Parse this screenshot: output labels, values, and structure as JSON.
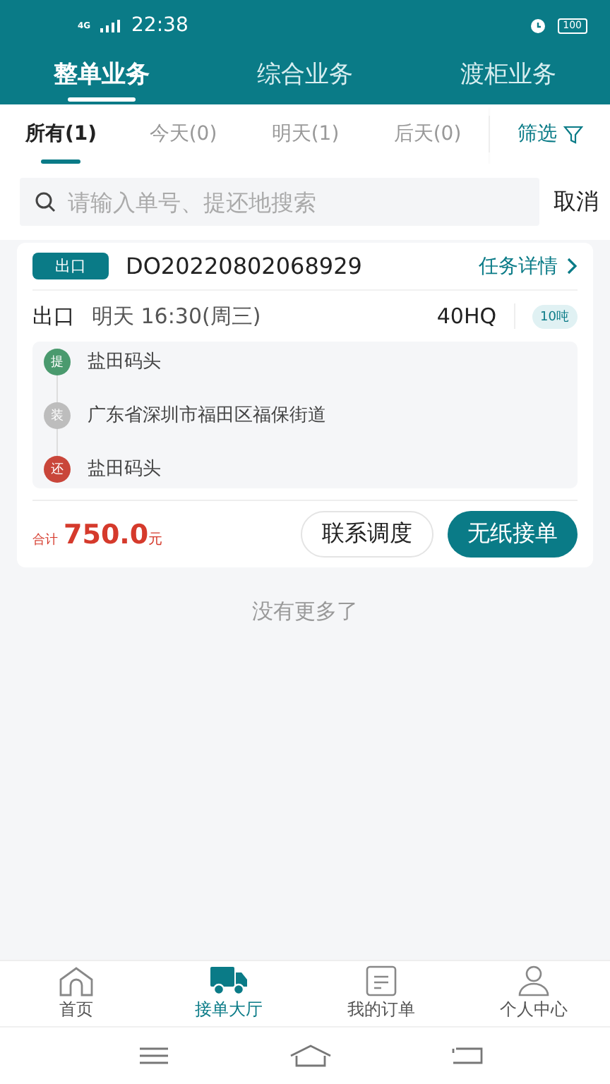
{
  "status_bar": {
    "network": "4G",
    "time": "22:38",
    "battery": "100"
  },
  "top_tabs": [
    {
      "label": "整单业务",
      "selected": true
    },
    {
      "label": "综合业务",
      "selected": false
    },
    {
      "label": "渡柜业务",
      "selected": false
    }
  ],
  "date_tabs": [
    {
      "label": "所有(1)",
      "selected": true
    },
    {
      "label": "今天(0)",
      "selected": false
    },
    {
      "label": "明天(1)",
      "selected": false
    },
    {
      "label": "后天(0)",
      "selected": false
    }
  ],
  "filter": {
    "label": "筛选"
  },
  "search": {
    "placeholder": "请输入单号、提还地搜索",
    "cancel": "取消"
  },
  "orders": [
    {
      "type_tag": "出口",
      "order_no": "DO20220802068929",
      "detail_link": "任务详情",
      "type": "出口",
      "time": "明天 16:30(周三)",
      "container": "40HQ",
      "weight": "10吨",
      "stops": [
        {
          "mark": "提",
          "color": "#4a9a6e",
          "place": "盐田码头"
        },
        {
          "mark": "装",
          "color": "#bdbdbd",
          "place": "广东省深圳市福田区福保街道"
        },
        {
          "mark": "还",
          "color": "#c9463a",
          "place": "盐田码头"
        }
      ],
      "total_label": "合计",
      "amount": "750.0",
      "unit": "元",
      "buttons": [
        {
          "label": "联系调度",
          "kind": "outline"
        },
        {
          "label": "无纸接单",
          "kind": "primary"
        }
      ]
    }
  ],
  "end_note": "没有更多了",
  "bottom_nav": [
    {
      "label": "首页",
      "selected": false
    },
    {
      "label": "接单大厅",
      "selected": true
    },
    {
      "label": "我的订单",
      "selected": false
    },
    {
      "label": "个人中心",
      "selected": false
    }
  ]
}
